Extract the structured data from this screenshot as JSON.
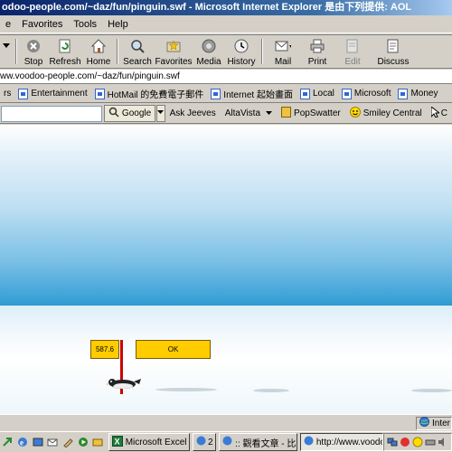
{
  "window": {
    "title": "odoo-people.com/~daz/fun/pinguin.swf - Microsoft Internet Explorer 是由下列提供: AOL"
  },
  "menu": {
    "items": [
      {
        "label": "e"
      },
      {
        "label": "Favorites"
      },
      {
        "label": "Tools"
      },
      {
        "label": "Help"
      }
    ]
  },
  "toolbar": {
    "buttons": [
      {
        "label": "",
        "icon": "chevron-down-icon"
      },
      {
        "label": "Stop",
        "icon": "stop-icon"
      },
      {
        "label": "Refresh",
        "icon": "refresh-icon"
      },
      {
        "label": "Home",
        "icon": "home-icon"
      },
      {
        "label": "Search",
        "icon": "search-icon"
      },
      {
        "label": "Favorites",
        "icon": "favorites-icon"
      },
      {
        "label": "Media",
        "icon": "media-icon"
      },
      {
        "label": "History",
        "icon": "history-icon"
      },
      {
        "label": "Mail",
        "icon": "mail-icon"
      },
      {
        "label": "Print",
        "icon": "print-icon"
      },
      {
        "label": "Edit",
        "icon": "edit-icon"
      },
      {
        "label": "Discuss",
        "icon": "discuss-icon"
      }
    ]
  },
  "address": {
    "value": "ww.voodoo-people.com/~daz/fun/pinguin.swf"
  },
  "links": {
    "items": [
      {
        "label": "rs"
      },
      {
        "label": "Entertainment"
      },
      {
        "label": "HotMail 的免費電子郵件"
      },
      {
        "label": "Internet 起始畫面"
      },
      {
        "label": "Local"
      },
      {
        "label": "Microsoft"
      },
      {
        "label": "Money"
      }
    ]
  },
  "searchbar": {
    "google_label": "Google",
    "items": [
      {
        "label": "Ask Jeeves"
      },
      {
        "label": "AltaVista"
      },
      {
        "label": "PopSwatter"
      },
      {
        "label": "Smiley Central"
      },
      {
        "label": "C"
      }
    ]
  },
  "game": {
    "distance": "587.6",
    "ok_label": "OK"
  },
  "status": {
    "zone_label": "Inter"
  },
  "taskbar": {
    "tasks": [
      {
        "label": "Microsoft Excel - i..."
      },
      {
        "label": "2"
      },
      {
        "label": ":: 觀看文章 - 比..."
      },
      {
        "label": "http://www.voodo..."
      }
    ]
  }
}
